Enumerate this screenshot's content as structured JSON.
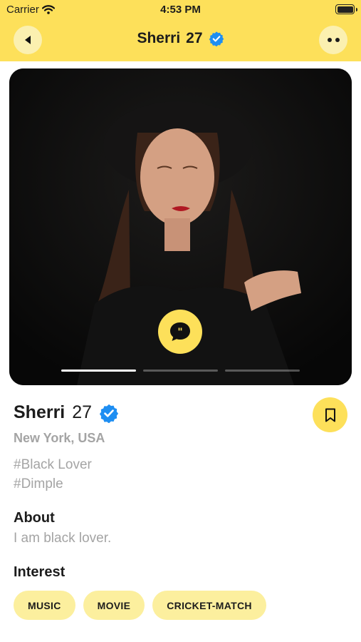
{
  "status_bar": {
    "carrier": "Carrier",
    "time": "4:53 PM"
  },
  "nav": {
    "name": "Sherri",
    "age": "27"
  },
  "profile": {
    "name": "Sherri",
    "age": "27",
    "location": "New York, USA",
    "tags": [
      "#Black Lover",
      "#Dimple"
    ],
    "about_heading": "About",
    "about_text": "I am black lover.",
    "interest_heading": "Interest",
    "interests": [
      "MUSIC",
      "MOVIE",
      "CRICKET-MATCH"
    ]
  },
  "photo": {
    "image_count": 3,
    "active_index": 0
  },
  "colors": {
    "accent": "#fde05a",
    "accent_light": "#fcef9e",
    "verified": "#1e8ef2",
    "muted_text": "#a4a4a4"
  },
  "icons": [
    "wifi-icon",
    "battery-icon",
    "back-arrow-icon",
    "more-dots-icon",
    "verified-badge-icon",
    "chat-quote-icon",
    "bookmark-icon"
  ]
}
